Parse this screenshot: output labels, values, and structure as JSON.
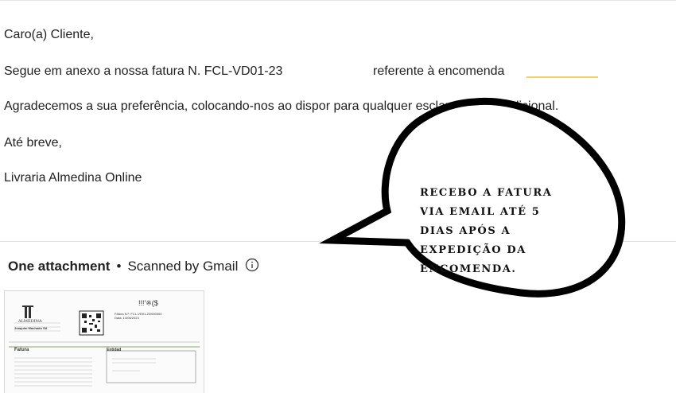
{
  "email": {
    "greeting": "Caro(a) Cliente,",
    "line1_prefix": "Segue em anexo a nossa fatura N. FCL-VD01-23",
    "line1_suffix": "referente à encomenda",
    "line2": "Agradecemos a sua preferência, colocando-nos ao dispor para qualquer esclarecimento adicional.",
    "closing": "Até breve,",
    "signature": "Livraria Almedina Online"
  },
  "attachments": {
    "heading": "One attachment",
    "separator": "•",
    "scan_note": "Scanned by Gmail",
    "info_icon": "info-icon"
  },
  "thumbnail": {
    "brand": "ALMEDINA",
    "sender_name": "Joaquim Machado SA",
    "section_left": "Fatura",
    "section_right": "Entidad",
    "invoice_label": "Fatura N.º: FCL-VD01-23/000000",
    "date_label": "Data: 14/06/2023",
    "code": "!!!'※($"
  },
  "annotation": {
    "lines": [
      "RECEBO A FATURA",
      "VIA EMAIL ATÉ 5",
      "DIAS APÓS A",
      "EXPEDIÇÃO DA",
      "ENCOMENDA."
    ]
  }
}
